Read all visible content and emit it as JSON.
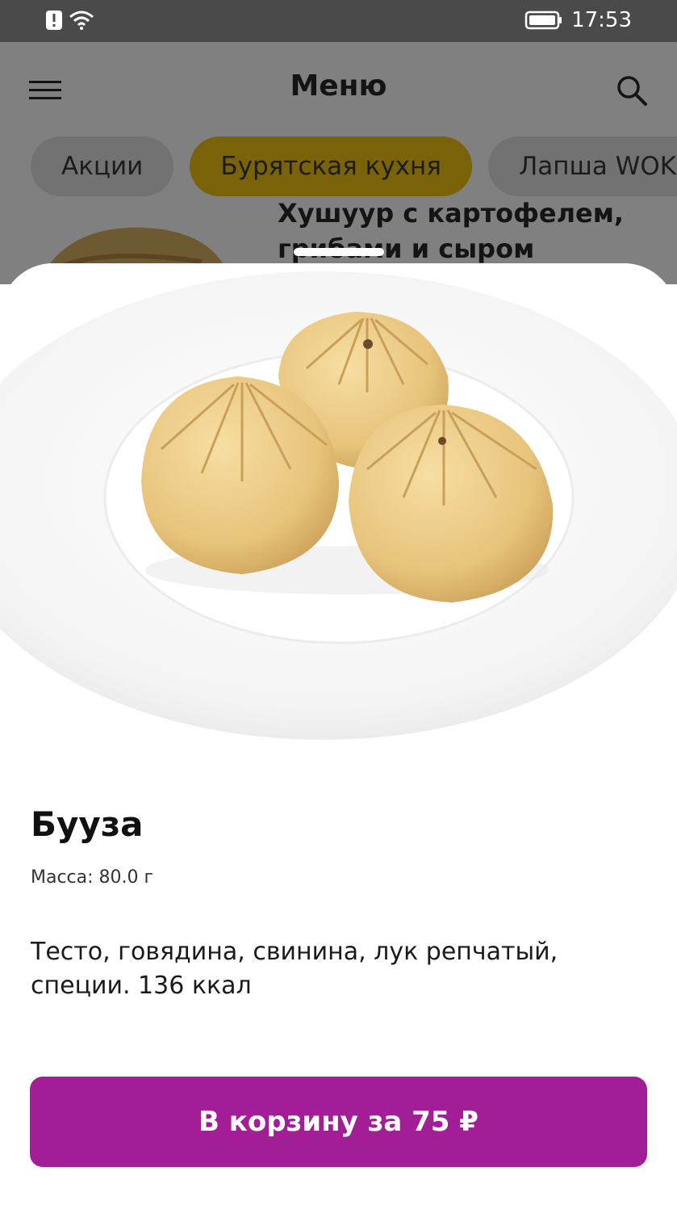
{
  "status_bar": {
    "time": "17:53",
    "icons": [
      "alert-icon",
      "wifi-icon",
      "battery-icon"
    ]
  },
  "app_bar": {
    "title": "Меню"
  },
  "categories": [
    {
      "label": "Акции",
      "active": false
    },
    {
      "label": "Бурятская кухня",
      "active": true
    },
    {
      "label": "Лапша WOK",
      "active": false
    }
  ],
  "background_item": {
    "title": "Хушуур с картофелем, грибами и сыром"
  },
  "product": {
    "name": "Бууза",
    "weight": "Масса: 80.0 г",
    "description": "Тесто, говядина, свинина, лук репчатый, специи. 136 ккал",
    "add_to_cart_label": "В корзину за 75 ₽"
  },
  "colors": {
    "accent": "#a21d96",
    "active_tab": "#f0c20d",
    "status_bar": "#4a4a4a"
  }
}
